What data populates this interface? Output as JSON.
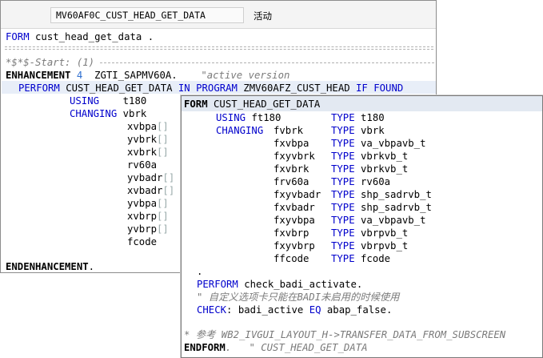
{
  "header": {
    "program": "MV60AF0C_CUST_HEAD_GET_DATA",
    "status": "活动"
  },
  "main": {
    "l1_form": "FORM",
    "l1_name": "cust_head_get_data",
    "l1_dot": " .",
    "l3_marker": "*$*$-Start: (1)",
    "l4_enh": "ENHANCEMENT",
    "l4_num": "4",
    "l4_id": "ZGTI_SAPMV60A.",
    "l4_comment": "\"active version",
    "l5_perform": "PERFORM",
    "l5_name": "CUST_HEAD_GET_DATA",
    "l5_in": "IN PROGRAM",
    "l5_prog": "ZMV60AFZ_CUST_HEAD",
    "l5_if": "IF FOUND",
    "using": "USING",
    "using_val": "t180",
    "changing": "CHANGING",
    "changing_val": "vbrk",
    "params": [
      "xvbpa",
      "yvbrk",
      "xvbrk",
      "rv60a",
      "yvbadr",
      "xvbadr",
      "yvbpa",
      "xvbrp",
      "yvbrp",
      "fcode"
    ],
    "param_brackets": [
      "[]",
      "[]",
      "[]",
      "",
      "[]",
      "[]",
      "[]",
      "[]",
      "[]",
      ""
    ],
    "endenh": "ENDENHANCEMENT",
    "endenh_dot": "."
  },
  "popup": {
    "form": "FORM",
    "name": "CUST_HEAD_GET_DATA",
    "using": "USING",
    "using_param": "ft180",
    "type_kw": "TYPE",
    "using_type": "t180",
    "changing": "CHANGING",
    "rows": [
      {
        "param": "fvbrk",
        "type": "vbrk"
      },
      {
        "param": "fxvbpa",
        "type": "va_vbpavb_t"
      },
      {
        "param": "fxyvbrk",
        "type": "vbrkvb_t"
      },
      {
        "param": "fxvbrk",
        "type": "vbrkvb_t"
      },
      {
        "param": "frv60a",
        "type": "rv60a"
      },
      {
        "param": "fxyvbadr",
        "type": "shp_sadrvb_t"
      },
      {
        "param": "fxvbadr",
        "type": "shp_sadrvb_t"
      },
      {
        "param": "fxyvbpa",
        "type": "va_vbpavb_t"
      },
      {
        "param": "fxvbrp",
        "type": "vbrpvb_t"
      },
      {
        "param": "fxyvbrp",
        "type": "vbrpvb_t"
      },
      {
        "param": "ffcode",
        "type": "fcode"
      }
    ],
    "dot": ".",
    "perform": "PERFORM",
    "perform_target": "check_badi_activate.",
    "comment1": "\" 自定义选项卡只能在BADI未启用的时候使用",
    "check": "CHECK",
    "check_rest": ": badi_active",
    "eq": "EQ",
    "check_val": "abap_false.",
    "comment2": "* 参考 WB2_IVGUI_LAYOUT_H->TRANSFER_DATA_FROM_SUBSCREEN",
    "endform": "ENDFORM",
    "endform_comment": ".   \" CUST_HEAD_GET_DATA"
  }
}
